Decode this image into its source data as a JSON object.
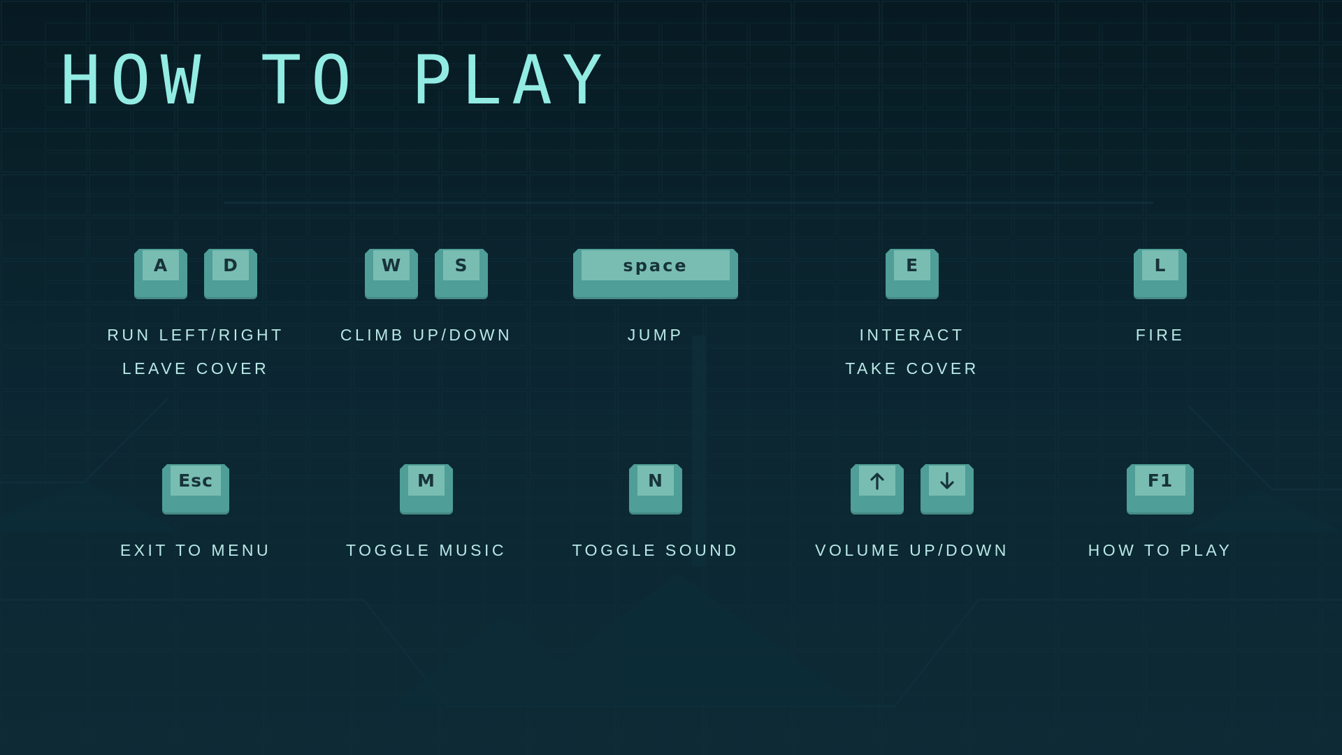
{
  "screen": {
    "title": "HOW TO PLAY"
  },
  "colors": {
    "background": "#0b2631",
    "title": "#93ece3",
    "key_base": "#4f9e97",
    "key_cap": "#79bdb2",
    "key_text": "#17333a",
    "label": "#b9e9e6"
  },
  "controls": [
    {
      "keys": [
        "A",
        "D"
      ],
      "labels": [
        "RUN LEFT/RIGHT",
        "LEAVE COVER"
      ]
    },
    {
      "keys": [
        "W",
        "S"
      ],
      "labels": [
        "CLIMB UP/DOWN"
      ]
    },
    {
      "keys": [
        "space"
      ],
      "labels": [
        "JUMP"
      ]
    },
    {
      "keys": [
        "E"
      ],
      "labels": [
        "INTERACT",
        "TAKE COVER"
      ]
    },
    {
      "keys": [
        "L"
      ],
      "labels": [
        "FIRE"
      ]
    },
    {
      "keys": [
        "Esc"
      ],
      "labels": [
        "EXIT TO MENU"
      ]
    },
    {
      "keys": [
        "M"
      ],
      "labels": [
        "TOGGLE MUSIC"
      ]
    },
    {
      "keys": [
        "N"
      ],
      "labels": [
        "TOGGLE SOUND"
      ]
    },
    {
      "keys": [
        "arrow-up-icon",
        "arrow-down-icon"
      ],
      "labels": [
        "VOLUME UP/DOWN"
      ]
    },
    {
      "keys": [
        "F1"
      ],
      "labels": [
        "HOW TO PLAY"
      ]
    }
  ]
}
